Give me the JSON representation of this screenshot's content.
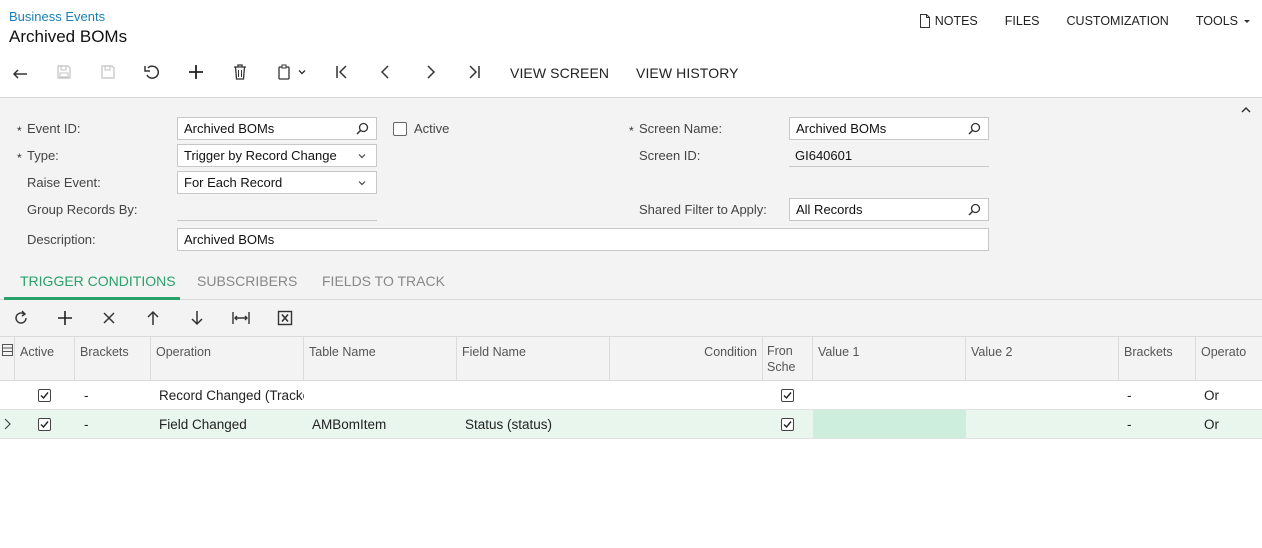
{
  "header": {
    "breadcrumb": "Business Events",
    "title": "Archived BOMs",
    "links": {
      "notes": "NOTES",
      "files": "FILES",
      "customization": "CUSTOMIZATION",
      "tools": "TOOLS"
    }
  },
  "toolbar": {
    "view_screen": "VIEW SCREEN",
    "view_history": "VIEW HISTORY"
  },
  "form": {
    "event_id_label": "Event ID:",
    "event_id_value": "Archived BOMs",
    "active_label": "Active",
    "type_label": "Type:",
    "type_value": "Trigger by Record Change",
    "raise_event_label": "Raise Event:",
    "raise_event_value": "For Each Record",
    "group_records_label": "Group Records By:",
    "group_records_value": "",
    "description_label": "Description:",
    "description_value": "Archived BOMs",
    "screen_name_label": "Screen Name:",
    "screen_name_value": "Archived BOMs",
    "screen_id_label": "Screen ID:",
    "screen_id_value": "GI640601",
    "shared_filter_label": "Shared Filter to Apply:",
    "shared_filter_value": "All Records",
    "required_mark": "*"
  },
  "tabs": [
    {
      "label": "TRIGGER CONDITIONS",
      "active": true
    },
    {
      "label": "SUBSCRIBERS",
      "active": false
    },
    {
      "label": "FIELDS TO TRACK",
      "active": false
    }
  ],
  "grid": {
    "columns": {
      "active": "Active",
      "brackets": "Brackets",
      "operation": "Operation",
      "table_name": "Table Name",
      "field_name": "Field Name",
      "condition": "Condition",
      "from_schema": "From Sche",
      "from_schema_l1": "Fron",
      "from_schema_l2": "Sche",
      "value1": "Value 1",
      "value2": "Value 2",
      "brackets2": "Brackets",
      "operator": "Operato"
    },
    "rows": [
      {
        "active": true,
        "brackets": "-",
        "operation": "Record Changed (Tracke",
        "table_name": "",
        "field_name": "",
        "condition": "",
        "from_schema": true,
        "value1": "",
        "value2": "",
        "brackets2": "-",
        "operator": "Or"
      },
      {
        "active": true,
        "brackets": "-",
        "operation": "Field Changed",
        "table_name": "AMBomItem",
        "field_name": "Status (status)",
        "condition": "",
        "from_schema": true,
        "value1": "",
        "value2": "",
        "brackets2": "-",
        "operator": "Or"
      }
    ]
  },
  "colors": {
    "accent": "#2aa06a",
    "link": "#1a7fb8",
    "selected_row": "#e8f6ee"
  }
}
